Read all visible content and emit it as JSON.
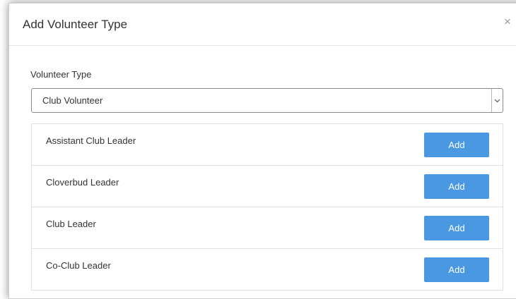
{
  "modal": {
    "title": "Add Volunteer Type",
    "close_glyph": "×"
  },
  "form": {
    "volunteer_type_label": "Volunteer Type",
    "volunteer_type_selected": "Club Volunteer",
    "dropdown_icon": "chevron-down-icon"
  },
  "roles": [
    {
      "label": "Assistant Club Leader",
      "button": "Add"
    },
    {
      "label": "Cloverbud Leader",
      "button": "Add"
    },
    {
      "label": "Club Leader",
      "button": "Add"
    },
    {
      "label": "Co-Club Leader",
      "button": "Add"
    }
  ],
  "colors": {
    "add_button_bg": "#4a98e2",
    "add_button_text": "#ffffff"
  }
}
